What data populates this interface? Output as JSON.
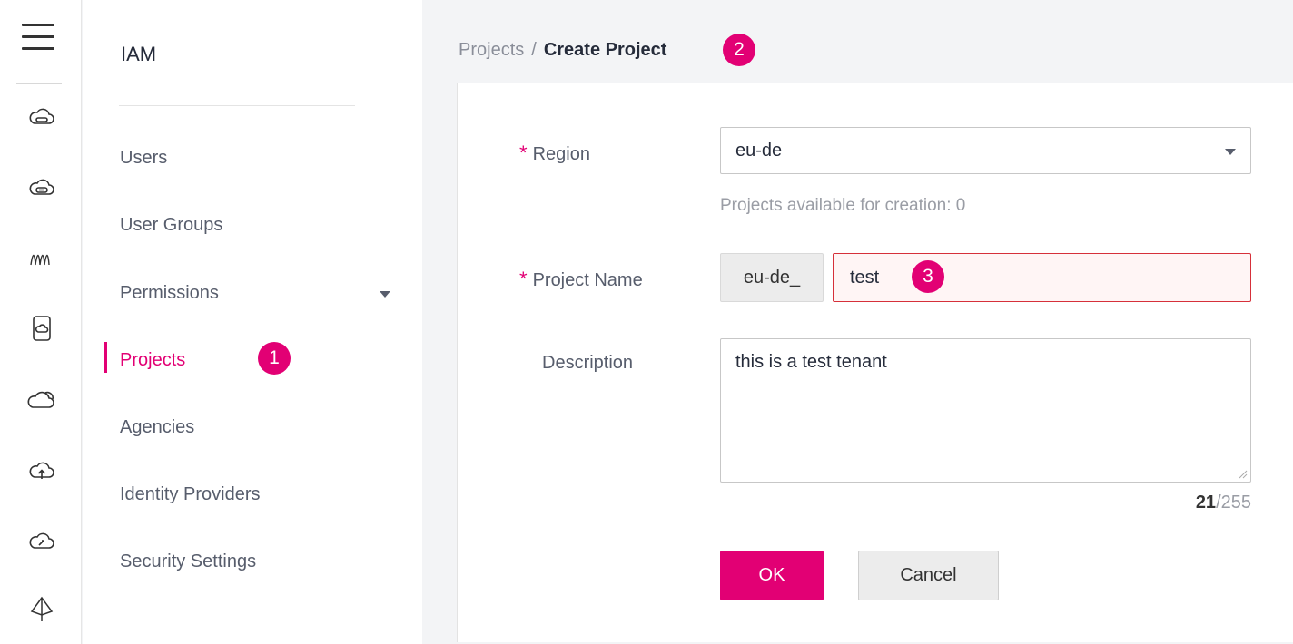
{
  "rail": {
    "icons": [
      "menu-icon",
      "cloud-server-icon",
      "cloud-storage-icon",
      "monitoring-icon",
      "mobile-cloud-icon",
      "cloud-icon",
      "cloud-upload-icon",
      "cloud-speed-icon",
      "network-icon"
    ]
  },
  "sidebar": {
    "title": "IAM",
    "items": [
      {
        "label": "Users"
      },
      {
        "label": "User Groups"
      },
      {
        "label": "Permissions"
      },
      {
        "label": "Projects",
        "active": true
      },
      {
        "label": "Agencies"
      },
      {
        "label": "Identity Providers"
      },
      {
        "label": "Security Settings"
      }
    ]
  },
  "breadcrumb": {
    "parent": "Projects",
    "separator": "/",
    "current": "Create Project"
  },
  "badges": {
    "one": "1",
    "two": "2",
    "three": "3"
  },
  "form": {
    "required_mark": "*",
    "region_label": "Region",
    "region_value": "eu-de",
    "region_hint": "Projects available for creation: 0",
    "project_name_label": "Project Name",
    "project_name_prefix": "eu-de_",
    "project_name_value": "test",
    "description_label": "Description",
    "description_value": "this is a test tenant",
    "char_count": "21",
    "char_max": "/255",
    "ok_label": "OK",
    "cancel_label": "Cancel"
  },
  "colors": {
    "accent": "#e20074",
    "error_border": "#d6303a"
  }
}
